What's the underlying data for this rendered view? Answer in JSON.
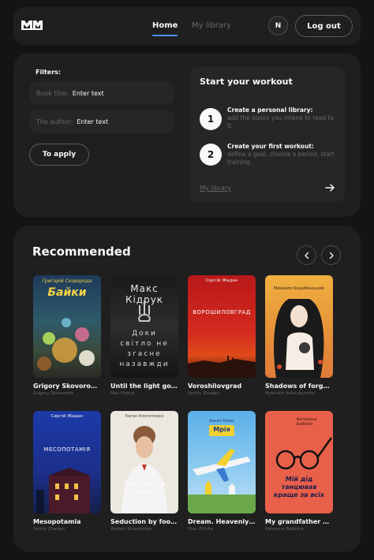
{
  "header": {
    "nav_home": "Home",
    "nav_library": "My library",
    "avatar_letter": "N",
    "logout_label": "Log out"
  },
  "filters": {
    "title": "Filters:",
    "book_title_label": "Book title:",
    "book_title_value": "Enter text",
    "author_label": "The author:",
    "author_value": "Enter text",
    "apply_label": "To apply"
  },
  "workout": {
    "title": "Start your workout",
    "steps": [
      {
        "num": "1",
        "title": "Create a personal library:",
        "text": "add the books you intend to read to it."
      },
      {
        "num": "2",
        "title": "Create your first workout:",
        "text": "define a goal, choose a period, start training."
      }
    ],
    "link_label": "My library"
  },
  "recommended": {
    "title": "Recommended",
    "books": [
      {
        "title": "Grigory Skovoroda...",
        "author": "Grigory Skovoroda",
        "cover_text": "Байки",
        "cover_top": "Григорій Сковорода"
      },
      {
        "title": "Until the light goes ...",
        "author": "Max Kidruk",
        "cover_text": "Доки світло не згасне назавжди",
        "cover_top": "Макс Кідрук"
      },
      {
        "title": "Voroshilovgrad",
        "author": "Serhiy Zhadan",
        "cover_text": "ВОРОШИЛОВГРАД",
        "cover_top": "Сергій Жадан"
      },
      {
        "title": "Shadows of forgott...",
        "author": "Mykhailo Kotsiubynskyi",
        "cover_text": "",
        "cover_top": "Михайло Коцюбинський"
      },
      {
        "title": "Mesopotamia",
        "author": "Serhiy Zhadan",
        "cover_text": "МЕСОПОТАМІЯ",
        "cover_top": "Сергій Жадан"
      },
      {
        "title": "Seduction by food. ...",
        "author": "Yevhen Klopotenko",
        "cover_text": "Звабленн я їжею",
        "cover_top": "Євген Клопотенко"
      },
      {
        "title": "Dream. Heavenly al...",
        "author": "Stas Zhivka",
        "cover_text": "Мрія",
        "cover_top": "Бахил Блакі"
      },
      {
        "title": "My grandfather dae...",
        "author": "Kateryna Babkina",
        "cover_text": "Мій дід танцював краще за всіх",
        "cover_top": "Катерина Бабкіна"
      }
    ]
  },
  "colors": {
    "background": "#141414",
    "panel": "#1f1f1f",
    "field": "#262626",
    "accent": "#4f92f7",
    "muted": "#686868"
  }
}
